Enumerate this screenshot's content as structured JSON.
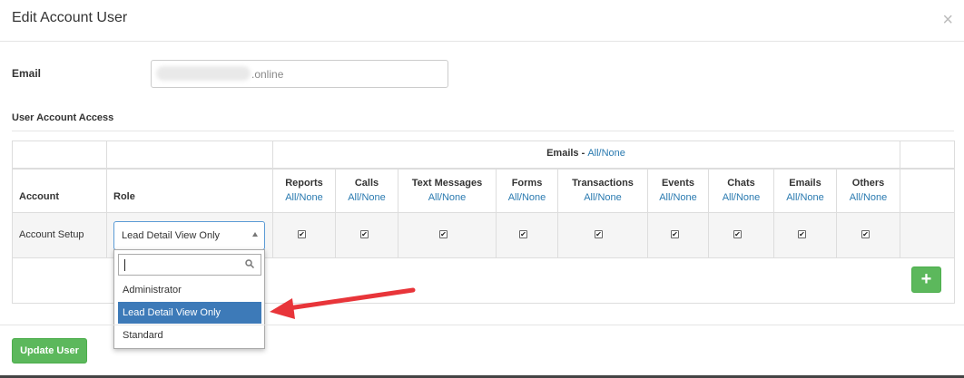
{
  "modal": {
    "title": "Edit Account User",
    "close_glyph": "×"
  },
  "email": {
    "label": "Email",
    "value_visible": ".online"
  },
  "access": {
    "label": "User Account Access"
  },
  "table": {
    "emails_group_label": "Emails - ",
    "emails_group_link": "All/None",
    "headers": {
      "account": "Account",
      "role": "Role",
      "columns": [
        {
          "label": "Reports",
          "link": "All/None"
        },
        {
          "label": "Calls",
          "link": "All/None"
        },
        {
          "label": "Text Messages",
          "link": "All/None"
        },
        {
          "label": "Forms",
          "link": "All/None"
        },
        {
          "label": "Transactions",
          "link": "All/None"
        },
        {
          "label": "Events",
          "link": "All/None"
        },
        {
          "label": "Chats",
          "link": "All/None"
        },
        {
          "label": "Emails",
          "link": "All/None"
        },
        {
          "label": "Others",
          "link": "All/None"
        }
      ]
    },
    "row": {
      "account": "Account Setup",
      "role_selected": "Lead Detail View Only",
      "checked": [
        true,
        true,
        true,
        true,
        true,
        true,
        true,
        true,
        true
      ]
    }
  },
  "dropdown": {
    "search_value": "",
    "options": [
      "Administrator",
      "Lead Detail View Only",
      "Standard"
    ],
    "highlighted": "Lead Detail View Only"
  },
  "buttons": {
    "add": "+",
    "update": "Update User"
  },
  "colors": {
    "accent_green": "#5cb85c",
    "link_blue": "#2a7ab0",
    "selected_blue": "#3d7ab8",
    "annotation_red": "#e8353a"
  }
}
